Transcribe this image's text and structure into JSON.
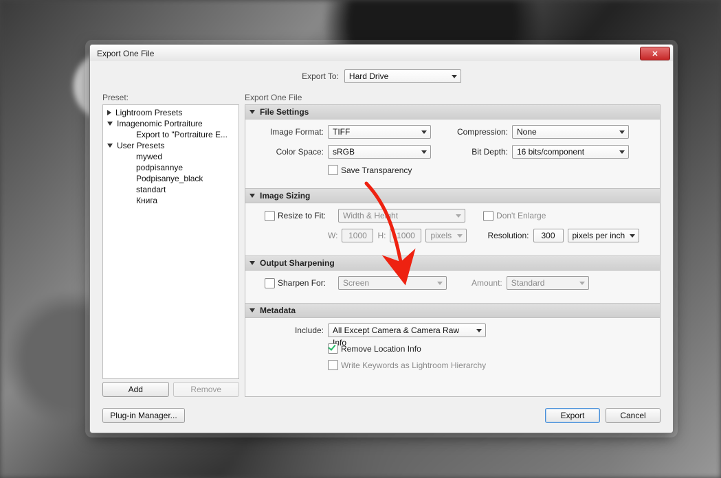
{
  "window": {
    "title": "Export One File"
  },
  "exportTo": {
    "label": "Export To:",
    "value": "Hard Drive"
  },
  "preset": {
    "heading": "Preset:",
    "tree": [
      {
        "kind": "group-closed",
        "label": "Lightroom Presets"
      },
      {
        "kind": "group-open",
        "label": "Imagenomic Portraiture"
      },
      {
        "kind": "leaf",
        "label": "Export to \"Portraiture E..."
      },
      {
        "kind": "group-open",
        "label": "User Presets"
      },
      {
        "kind": "leaf",
        "label": "mywed"
      },
      {
        "kind": "leaf",
        "label": "podpisannye"
      },
      {
        "kind": "leaf",
        "label": "Podpisanye_black"
      },
      {
        "kind": "leaf",
        "label": "standart"
      },
      {
        "kind": "leaf",
        "label": "Книга"
      }
    ],
    "add": "Add",
    "remove": "Remove"
  },
  "rightHeading": "Export One File",
  "sections": {
    "fileSettings": {
      "title": "File Settings",
      "imageFormat": {
        "label": "Image Format:",
        "value": "TIFF"
      },
      "compression": {
        "label": "Compression:",
        "value": "None"
      },
      "colorSpace": {
        "label": "Color Space:",
        "value": "sRGB"
      },
      "bitDepth": {
        "label": "Bit Depth:",
        "value": "16 bits/component"
      },
      "saveTransparency": {
        "label": "Save Transparency",
        "checked": false
      }
    },
    "imageSizing": {
      "title": "Image Sizing",
      "resizeToFit": {
        "label": "Resize to Fit:",
        "checked": false,
        "mode": "Width & Height"
      },
      "dontEnlarge": {
        "label": "Don't Enlarge",
        "checked": false
      },
      "w": {
        "label": "W:",
        "value": "1000"
      },
      "h": {
        "label": "H:",
        "value": "1000"
      },
      "dimUnits": "pixels",
      "resolution": {
        "label": "Resolution:",
        "value": "300",
        "units": "pixels per inch"
      }
    },
    "outputSharpening": {
      "title": "Output Sharpening",
      "sharpenFor": {
        "label": "Sharpen For:",
        "checked": false,
        "value": "Screen"
      },
      "amount": {
        "label": "Amount:",
        "value": "Standard"
      }
    },
    "metadata": {
      "title": "Metadata",
      "include": {
        "label": "Include:",
        "value": "All Except Camera & Camera Raw Info"
      },
      "removeLocation": {
        "label": "Remove Location Info",
        "checked": true
      },
      "writeKeywords": {
        "label": "Write Keywords as Lightroom Hierarchy",
        "checked": false
      }
    }
  },
  "footer": {
    "pluginManager": "Plug-in Manager...",
    "export": "Export",
    "cancel": "Cancel"
  }
}
